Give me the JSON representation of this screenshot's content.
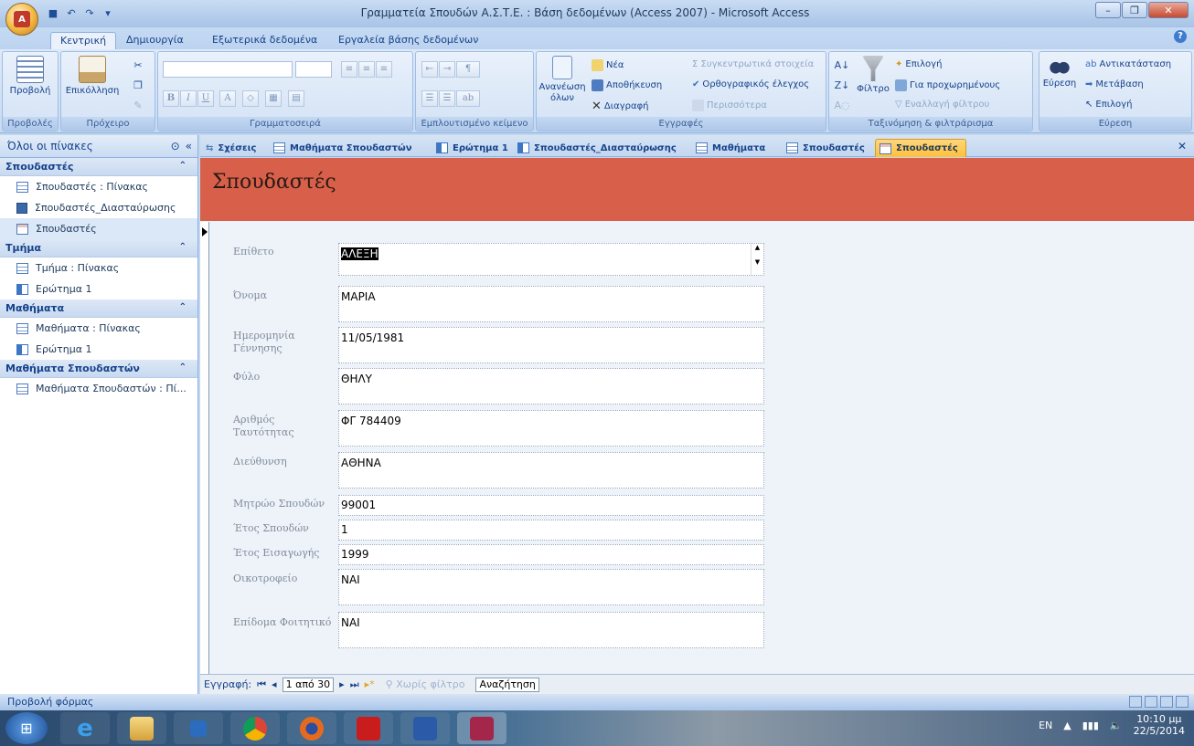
{
  "window": {
    "title": "Γραμματεία Σπουδών Α.Σ.Τ.Ε. : Βάση δεδομένων (Access 2007) - Microsoft Access"
  },
  "ribbon": {
    "tabs": [
      "Κεντρική",
      "Δημιουργία",
      "Εξωτερικά δεδομένα",
      "Εργαλεία βάσης δεδομένων"
    ],
    "groups": {
      "views": "Προβολές",
      "clipboard": "Πρόχειρο",
      "font": "Γραμματοσειρά",
      "rich_text": "Εμπλουτισμένο κείμενο",
      "records": "Εγγραφές",
      "sort_filter": "Ταξινόμηση & φιλτράρισμα",
      "find": "Εύρεση"
    },
    "buttons": {
      "view": "Προβολή",
      "paste": "Επικόλληση",
      "refresh": "Ανανέωση όλων",
      "new": "Νέα",
      "save": "Αποθήκευση",
      "delete": "Διαγραφή",
      "totals": "Σ Συγκεντρωτικά στοιχεία",
      "spelling": "Ορθογραφικός έλεγχος",
      "more": "Περισσότερα",
      "filter": "Φίλτρο",
      "selection": "Επιλογή",
      "advanced": "Για προχωρημένους",
      "toggle_filter": "Εναλλαγή φίλτρου",
      "find": "Εύρεση",
      "replace": "Αντικατάσταση",
      "goto": "Μετάβαση",
      "select": "Επιλογή"
    }
  },
  "nav": {
    "header": "Όλοι οι πίνακες",
    "groups": [
      {
        "title": "Σπουδαστές",
        "items": [
          "Σπουδαστές : Πίνακας",
          "Σπουδαστές_Διασταύρωσης",
          "Σπουδαστές"
        ]
      },
      {
        "title": "Τμήμα",
        "items": [
          "Τμήμα : Πίνακας",
          "Ερώτημα 1"
        ]
      },
      {
        "title": "Μαθήματα",
        "items": [
          "Μαθήματα : Πίνακας",
          "Ερώτημα 1"
        ]
      },
      {
        "title": "Μαθήματα Σπουδαστών",
        "items": [
          "Μαθήματα Σπουδαστών : Πί..."
        ]
      }
    ]
  },
  "doc_tabs": [
    "Σχέσεις",
    "Μαθήματα Σπουδαστών",
    "Ερώτημα 1",
    "Σπουδαστές_Διασταύρωσης",
    "Μαθήματα",
    "Σπουδαστές",
    "Σπουδαστές"
  ],
  "form": {
    "title": "Σπουδαστές",
    "fields": [
      {
        "label": "Επίθετο",
        "value": "ΑΛΕΞΗ"
      },
      {
        "label": "Όνομα",
        "value": "ΜΑΡΙΑ"
      },
      {
        "label": "Ημερομηνία Γέννησης",
        "value": "11/05/1981"
      },
      {
        "label": "Φύλο",
        "value": "ΘΗΛΥ"
      },
      {
        "label": "Αριθμός Ταυτότητας",
        "value": "ΦΓ 784409"
      },
      {
        "label": "Διεύθυνση",
        "value": "ΑΘΗΝΑ"
      },
      {
        "label": "Μητρώο Σπουδών",
        "value": "99001"
      },
      {
        "label": "Έτος Σπουδών",
        "value": "1"
      },
      {
        "label": "Έτος Εισαγωγής",
        "value": "1999"
      },
      {
        "label": "Οικοτροφείο",
        "value": "ΝΑΙ"
      },
      {
        "label": "Επίδομα Φοιτητικό",
        "value": "ΝΑΙ"
      }
    ]
  },
  "recnav": {
    "label": "Εγγραφή:",
    "position": "1 από 30",
    "no_filter": "Χωρίς φίλτρο",
    "search": "Αναζήτηση"
  },
  "status": {
    "text": "Προβολή φόρμας"
  },
  "taskbar": {
    "lang": "EN",
    "time": "10:10 μμ",
    "date": "22/5/2014"
  }
}
